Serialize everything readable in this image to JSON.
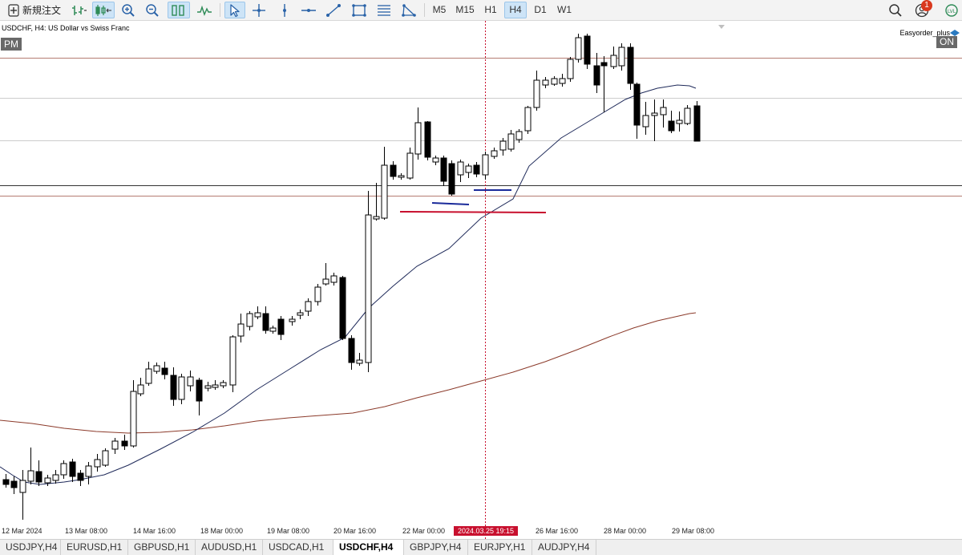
{
  "toolbar": {
    "new_order_label": "新規注文",
    "tools": [
      "bar-chart-icon",
      "candlestick-icon",
      "line-chart-icon",
      "zoom-in-icon",
      "zoom-out-icon",
      "tile-windows-icon",
      "indicators-icon",
      "cursor-icon",
      "crosshair-icon",
      "vertical-line-icon",
      "horizontal-line-icon",
      "trendline-icon",
      "rectangle-icon",
      "fibonacci-icon",
      "triangle-icon"
    ],
    "timeframes": [
      "M5",
      "M15",
      "H1",
      "H4",
      "D1",
      "W1"
    ],
    "active_timeframe": "H4",
    "notification_count": "1",
    "right_icons": [
      "search-icon",
      "account-icon",
      "signal-icon"
    ]
  },
  "chart": {
    "title": "USDCHF, H4:  US Dollar vs Swiss Franc",
    "session_label": "PM",
    "ea_name": "Easyorder_plus",
    "ea_status": "ON",
    "cursor_time": "2024.03.25 19:15",
    "x_labels": [
      "12 Mar 2024",
      "13 Mar 08:00",
      "14 Mar 16:00",
      "18 Mar 00:00",
      "19 Mar 08:00",
      "20 Mar 16:00",
      "22 Mar 00:00",
      "26 Mar 16:00",
      "28 Mar 00:00",
      "29 Mar 08:00"
    ],
    "colors": {
      "ma_fast": "#1f2a5a",
      "ma_slow": "#8b3a2a",
      "hline_brown": "#b57c72",
      "hline_gray": "#cccccc",
      "hline_dark": "#333333",
      "blue_trend": "#1a2a9a",
      "red_trend": "#c8102e",
      "cursor": "#c8102e"
    }
  },
  "symbol_tabs": [
    "USDJPY,H4",
    "EURUSD,H1",
    "GBPUSD,H1",
    "AUDUSD,H1",
    "USDCAD,H1",
    "USDCHF,H4",
    "GBPJPY,H4",
    "EURJPY,H1",
    "AUDJPY,H4"
  ],
  "active_symbol": "USDCHF,H4"
}
